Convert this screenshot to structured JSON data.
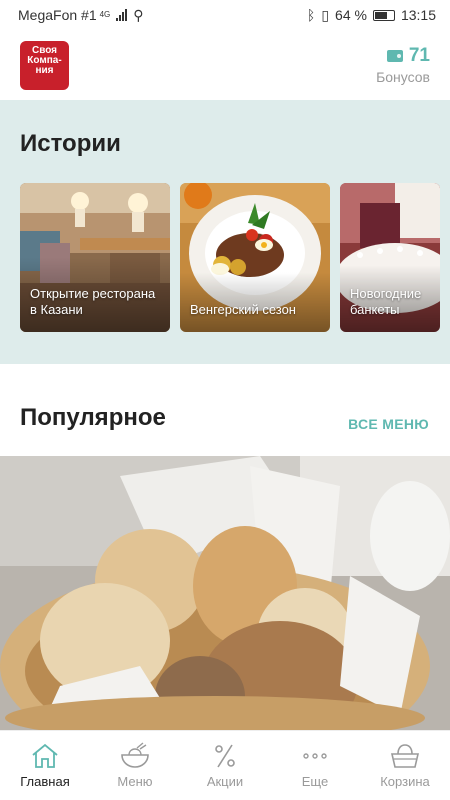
{
  "status_bar": {
    "carrier": "MegaFon #1",
    "network": "4G",
    "battery": "64 %",
    "time": "13:15"
  },
  "header": {
    "logo_text": "Своя Компа- ния",
    "bonus_count": "71",
    "bonus_label": "Бонусов"
  },
  "stories": {
    "title": "Истории",
    "items": [
      {
        "label": "Открытие ресторана в Казани"
      },
      {
        "label": "Венгерский сезон"
      },
      {
        "label": "Новогодние банкеты"
      }
    ]
  },
  "popular": {
    "title": "Популярное",
    "all_menu": "ВСЕ МЕНЮ"
  },
  "bottom_nav": {
    "items": [
      {
        "label": "Главная",
        "icon": "home-icon"
      },
      {
        "label": "Меню",
        "icon": "dish-icon"
      },
      {
        "label": "Акции",
        "icon": "percent-icon"
      },
      {
        "label": "Еще",
        "icon": "more-icon"
      },
      {
        "label": "Корзина",
        "icon": "basket-icon"
      }
    ]
  },
  "colors": {
    "accent": "#5fb8b0",
    "brand_red": "#c8202b",
    "stories_bg": "#deeceb"
  }
}
